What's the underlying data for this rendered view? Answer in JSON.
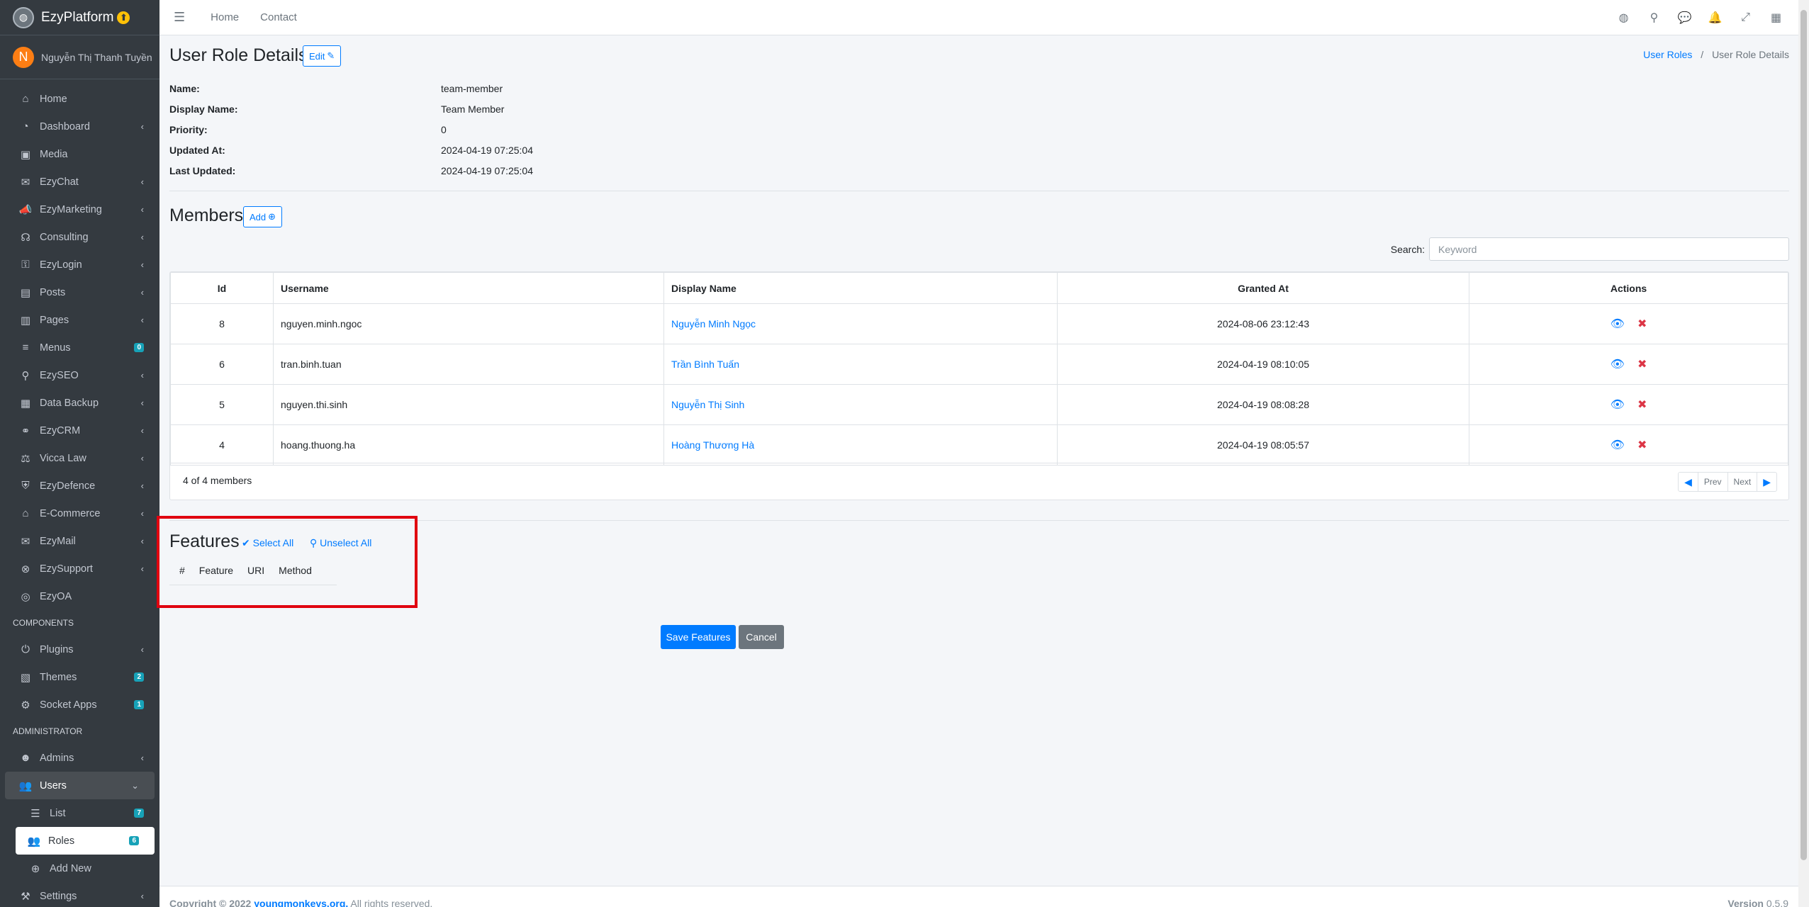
{
  "brand": {
    "name": "EzyPlatform",
    "badge": "⬆"
  },
  "user": {
    "initial": "N",
    "name": "Nguyễn Thị Thanh Tuyền"
  },
  "sidebar": {
    "items": [
      {
        "label": "Home",
        "icon": "⌂",
        "chevron": false
      },
      {
        "label": "Dashboard",
        "icon": "◔",
        "chevron": true
      },
      {
        "label": "Media",
        "icon": "▣",
        "chevron": false
      },
      {
        "label": "EzyChat",
        "icon": "✉",
        "chevron": true
      },
      {
        "label": "EzyMarketing",
        "icon": "📣",
        "chevron": true
      },
      {
        "label": "Consulting",
        "icon": "☊",
        "chevron": true
      },
      {
        "label": "EzyLogin",
        "icon": "⚿",
        "chevron": true
      },
      {
        "label": "Posts",
        "icon": "▤",
        "chevron": true
      },
      {
        "label": "Pages",
        "icon": "▥",
        "chevron": true
      },
      {
        "label": "Menus",
        "icon": "≡",
        "badge": "0"
      },
      {
        "label": "EzySEO",
        "icon": "⚲",
        "chevron": true
      },
      {
        "label": "Data Backup",
        "icon": "▦",
        "chevron": true
      },
      {
        "label": "EzyCRM",
        "icon": "⚭",
        "chevron": true
      },
      {
        "label": "Vicca Law",
        "icon": "⚖",
        "chevron": true
      },
      {
        "label": "EzyDefence",
        "icon": "⛨",
        "chevron": true
      },
      {
        "label": "E-Commerce",
        "icon": "⌂",
        "chevron": true
      },
      {
        "label": "EzyMail",
        "icon": "✉",
        "chevron": true
      },
      {
        "label": "EzySupport",
        "icon": "⊗",
        "chevron": true
      },
      {
        "label": "EzyOA",
        "icon": "◎",
        "chevron": false
      }
    ],
    "components_header": "COMPONENTS",
    "components": [
      {
        "label": "Plugins",
        "icon": "⏻",
        "chevron": true
      },
      {
        "label": "Themes",
        "icon": "▧",
        "badge": "2"
      },
      {
        "label": "Socket Apps",
        "icon": "⚙",
        "badge": "1"
      }
    ],
    "admin_header": "ADMINISTRATOR",
    "admin": [
      {
        "label": "Admins",
        "icon": "☻",
        "chevron": true
      }
    ],
    "users": {
      "label": "Users",
      "icon": "👥",
      "chevron": "⌄"
    },
    "users_sub": [
      {
        "label": "List",
        "icon": "☰",
        "badge": "7"
      },
      {
        "label": "Roles",
        "icon": "👥",
        "badge": "6"
      },
      {
        "label": "Add New",
        "icon": "⊕"
      }
    ],
    "settings": {
      "label": "Settings",
      "icon": "⚒",
      "chevron": true
    }
  },
  "topbar": {
    "links": [
      "Home",
      "Contact"
    ],
    "icons": [
      "globe-icon",
      "search-icon",
      "comments-icon",
      "bell-icon",
      "expand-icon",
      "grid-icon"
    ]
  },
  "page": {
    "title": "User Role Details",
    "edit_label": "Edit",
    "breadcrumb": {
      "parent": "User Roles",
      "current": "User Role Details"
    }
  },
  "details": [
    {
      "label": "Name:",
      "value": "team-member"
    },
    {
      "label": "Display Name:",
      "value": "Team Member"
    },
    {
      "label": "Priority:",
      "value": "0"
    },
    {
      "label": "Updated At:",
      "value": "2024-04-19 07:25:04"
    },
    {
      "label": "Last Updated:",
      "value": "2024-04-19 07:25:04"
    }
  ],
  "members": {
    "title": "Members",
    "add_label": "Add",
    "search_label": "Search:",
    "search_placeholder": "Keyword",
    "columns": [
      "Id",
      "Username",
      "Display Name",
      "Granted At",
      "Actions"
    ],
    "rows": [
      {
        "id": "8",
        "username": "nguyen.minh.ngoc",
        "display_name": "Nguyễn Minh Ngọc",
        "granted_at": "2024-08-06 23:12:43"
      },
      {
        "id": "6",
        "username": "tran.binh.tuan",
        "display_name": "Trần Bình Tuấn",
        "granted_at": "2024-04-19 08:10:05"
      },
      {
        "id": "5",
        "username": "nguyen.thi.sinh",
        "display_name": "Nguyễn Thị Sinh",
        "granted_at": "2024-04-19 08:08:28"
      },
      {
        "id": "4",
        "username": "hoang.thuong.ha",
        "display_name": "Hoàng Thương Hà",
        "granted_at": "2024-04-19 08:05:57"
      }
    ],
    "summary": "4 of 4 members",
    "pager": {
      "prev": "Prev",
      "next": "Next"
    }
  },
  "features": {
    "title": "Features",
    "select_all": "Select All",
    "unselect_all": "Unselect All",
    "columns": [
      "#",
      "Feature",
      "URI",
      "Method"
    ],
    "highlight_color": "#e0000f"
  },
  "actions": {
    "save": "Save Features",
    "cancel": "Cancel"
  },
  "footer": {
    "copyright": "Copyright © 2022",
    "link": "youngmonkeys.org.",
    "rights": "All rights reserved.",
    "version_label": "Version",
    "version": "0.5.9"
  }
}
